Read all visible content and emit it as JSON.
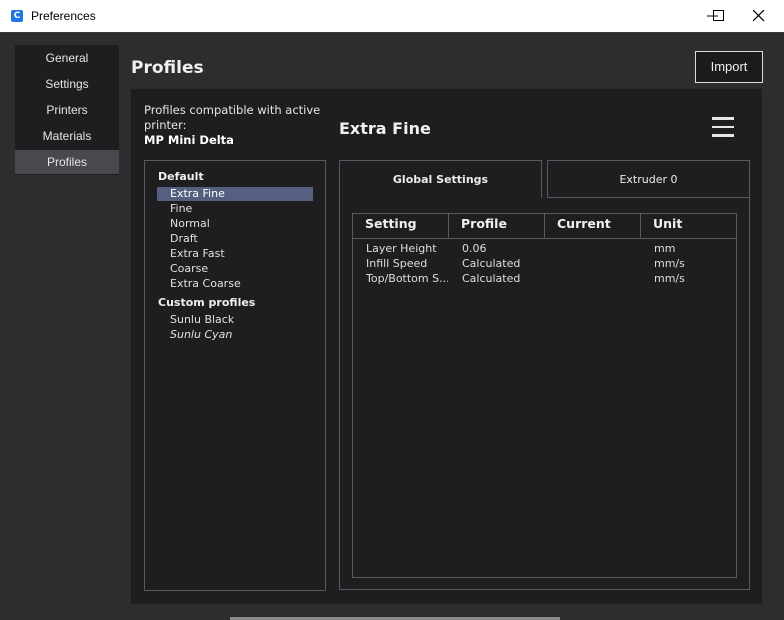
{
  "window": {
    "title": "Preferences",
    "icon_letter": "C"
  },
  "sidebar": {
    "items": [
      {
        "label": "General"
      },
      {
        "label": "Settings"
      },
      {
        "label": "Printers"
      },
      {
        "label": "Materials"
      },
      {
        "label": "Profiles",
        "active": true
      }
    ]
  },
  "page": {
    "title": "Profiles",
    "import_label": "Import"
  },
  "compat": {
    "text": "Profiles compatible with active printer:",
    "printer": "MP Mini Delta"
  },
  "profiles": {
    "default_group": "Default",
    "default_items": [
      "Extra Fine",
      "Fine",
      "Normal",
      "Draft",
      "Extra Fast",
      "Coarse",
      "Extra Coarse"
    ],
    "selected": "Extra Fine",
    "custom_group": "Custom profiles",
    "custom_items": [
      "Sunlu Black",
      "Sunlu Cyan"
    ]
  },
  "detail": {
    "name": "Extra Fine",
    "tabs": [
      "Global Settings",
      "Extruder 0"
    ],
    "columns": [
      "Setting",
      "Profile",
      "Current",
      "Unit"
    ],
    "rows": [
      {
        "setting": "Layer Height",
        "profile": "0.06",
        "current": "",
        "unit": "mm"
      },
      {
        "setting": "Infill Speed",
        "profile": "Calculated",
        "current": "",
        "unit": "mm/s"
      },
      {
        "setting": "Top/Bottom S...",
        "profile": "Calculated",
        "current": "",
        "unit": "mm/s"
      }
    ]
  },
  "icons": {
    "minimize": "minimize-icon",
    "maximize": "maximize-icon",
    "close": "close-icon",
    "menu": "hamburger-menu-icon"
  }
}
